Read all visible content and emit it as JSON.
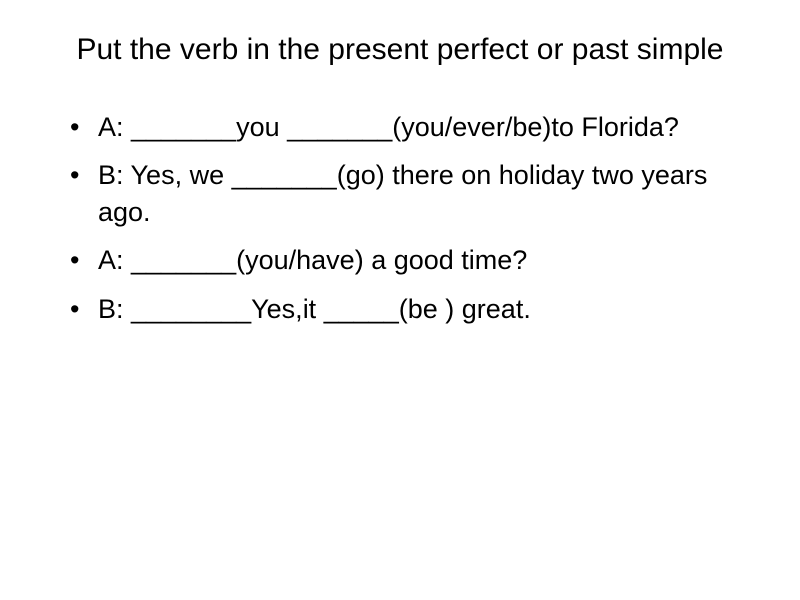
{
  "title": "Put the verb in the present perfect or past simple",
  "lines": {
    "l1": "A: _______you _______(you/ever/be)to Florida?",
    "l2": "B: Yes, we _______(go) there on holiday two years ago.",
    "l3": "A: _______(you/have) a good time?",
    "l4": "B: ________Yes,it _____(be ) great."
  }
}
